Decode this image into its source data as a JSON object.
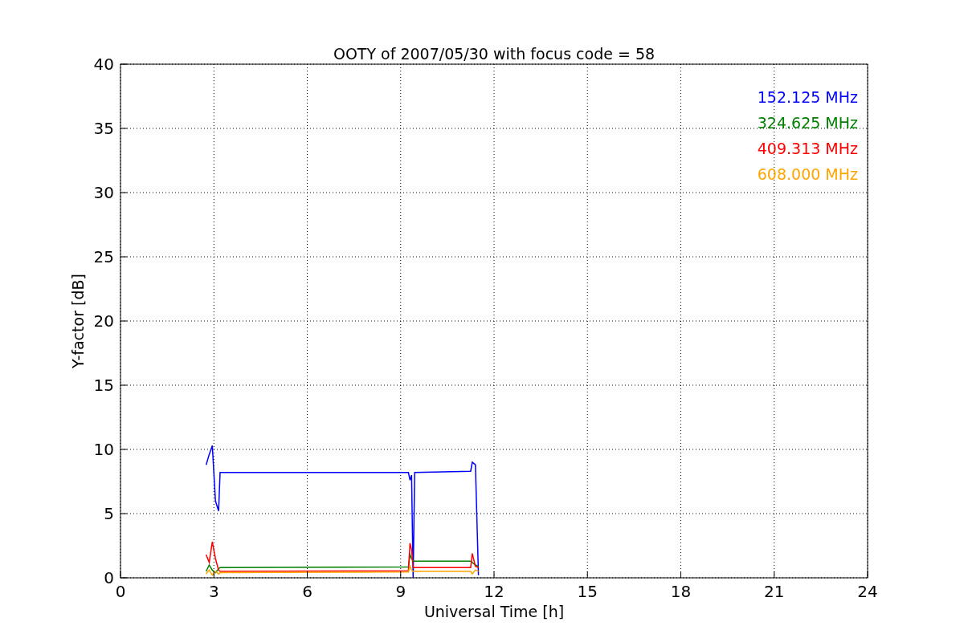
{
  "chart_data": {
    "type": "line",
    "title": "OOTY of 2007/05/30 with focus code = 58",
    "xlabel": "Universal Time [h]",
    "ylabel": "Y-factor [dB]",
    "x": [
      2.75,
      2.85,
      2.95,
      3.05,
      3.15,
      3.2,
      9.25,
      9.3,
      9.35,
      9.4,
      9.45,
      11.25,
      11.3,
      11.4,
      11.5
    ],
    "series": [
      {
        "name": "152.125 MHz",
        "color": "#0000ff",
        "values": [
          8.8,
          9.6,
          10.3,
          6.0,
          5.2,
          8.2,
          8.2,
          7.6,
          8.0,
          0,
          8.2,
          8.3,
          9.0,
          8.8,
          0.2
        ]
      },
      {
        "name": "324.625 MHz",
        "color": "#008000",
        "values": [
          0.5,
          1.0,
          0.6,
          0.4,
          0.7,
          0.8,
          0.85,
          1.8,
          1.5,
          1.3,
          1.3,
          1.3,
          1.2,
          1.0,
          0.9
        ]
      },
      {
        "name": "409.313 MHz",
        "color": "#ff0000",
        "values": [
          1.8,
          1.2,
          2.8,
          1.5,
          0.6,
          0.5,
          0.55,
          2.7,
          2.2,
          0.8,
          0.8,
          0.8,
          1.9,
          0.9,
          0.8
        ]
      },
      {
        "name": "608.000 MHz",
        "color": "#ffa500",
        "values": [
          0.3,
          0.6,
          0.2,
          0.5,
          0.3,
          0.4,
          0.45,
          0.9,
          0.6,
          0.5,
          0.5,
          0.5,
          0.3,
          0.6,
          0.5
        ]
      }
    ],
    "xlim": [
      0,
      24
    ],
    "ylim": [
      0,
      40
    ],
    "xticks": [
      0,
      3,
      6,
      9,
      12,
      15,
      18,
      21,
      24
    ],
    "yticks": [
      0,
      5,
      10,
      15,
      20,
      25,
      30,
      35,
      40
    ],
    "grid": true
  }
}
